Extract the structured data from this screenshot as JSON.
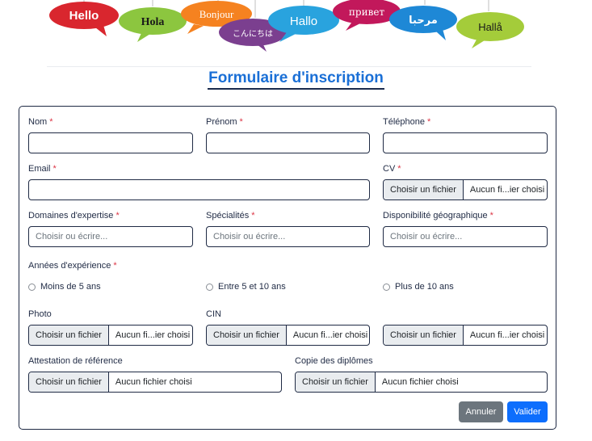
{
  "banner": {
    "words": [
      "Hello",
      "Hola",
      "Bonjour",
      "こんにちは",
      "Hallo",
      "привет",
      "مرحبا",
      "Hallå"
    ]
  },
  "form": {
    "title": "Formulaire d'inscription",
    "required_mark": "*",
    "fields": {
      "nom": {
        "label": "Nom",
        "value": ""
      },
      "prenom": {
        "label": "Prénom",
        "value": ""
      },
      "telephone": {
        "label": "Téléphone",
        "value": ""
      },
      "email": {
        "label": "Email",
        "value": ""
      },
      "cv": {
        "label": "CV",
        "button": "Choisir un fichier",
        "status": "Aucun fi...ier choisi"
      },
      "domaines": {
        "label": "Domaines d'expertise",
        "placeholder": "Choisir ou écrire..."
      },
      "specialites": {
        "label": "Spécialités",
        "placeholder": "Choisir ou écrire..."
      },
      "disponibilite": {
        "label": "Disponibilité géographique",
        "placeholder": "Choisir ou écrire..."
      },
      "experience": {
        "label": "Années d'expérience",
        "options": [
          "Moins de 5 ans",
          "Entre 5 et 10 ans",
          "Plus de 10 ans"
        ]
      },
      "photo": {
        "label": "Photo",
        "button": "Choisir un fichier",
        "status": "Aucun fi...ier choisi"
      },
      "cin": {
        "label": "CIN",
        "button": "Choisir un fichier",
        "status": "Aucun fi...ier choisi"
      },
      "third_file": {
        "button": "Choisir un fichier",
        "status": "Aucun fi...ier choisi"
      },
      "attestation": {
        "label": "Attestation de référence",
        "button": "Choisir un fichier",
        "status": "Aucun fichier choisi"
      },
      "diplomes": {
        "label": "Copie des diplômes",
        "button": "Choisir un fichier",
        "status": "Aucun fichier choisi"
      }
    },
    "actions": {
      "cancel": "Annuler",
      "submit": "Valider"
    }
  },
  "colors": {
    "accent": "#1a6fd6",
    "required": "#dc3545",
    "cancel_bg": "#6c757d",
    "submit_bg": "#0d6efd"
  }
}
